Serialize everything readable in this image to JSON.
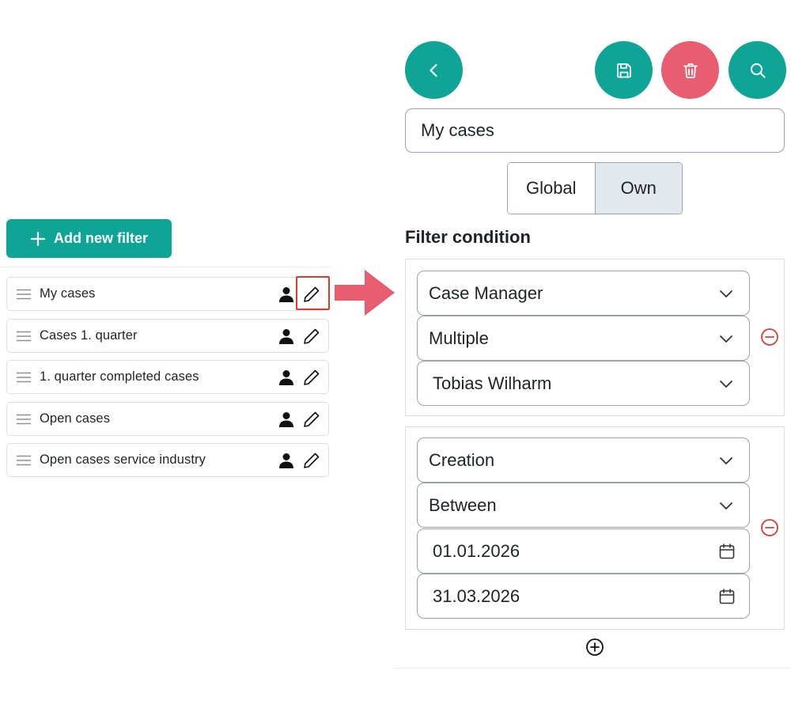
{
  "left_panel": {
    "add_filter_label": "Add new filter",
    "filters": [
      {
        "label": "My cases"
      },
      {
        "label": "Cases 1. quarter"
      },
      {
        "label": "1. quarter completed cases"
      },
      {
        "label": "Open cases"
      },
      {
        "label": "Open cases service industry"
      }
    ],
    "highlight_color": "#e03a2b",
    "arrow_color": "#e85d6f"
  },
  "toolbar": {
    "back_icon": "chevron-left-icon",
    "save_icon": "save-icon",
    "delete_icon": "trash-icon",
    "search_icon": "search-icon",
    "accent_color": "#0ea597",
    "danger_color": "#e85d6f"
  },
  "filter_name": {
    "value": "My cases"
  },
  "scope": {
    "options": [
      "Global",
      "Own"
    ],
    "selected": "Own"
  },
  "filter_condition": {
    "title": "Filter condition",
    "conditions": [
      {
        "field": "Case Manager",
        "operator": "Multiple",
        "values": [
          "Tobias Wilharm"
        ]
      },
      {
        "field": "Creation",
        "operator": "Between",
        "values": [
          "01.01.2026",
          "31.03.2026"
        ]
      }
    ],
    "add_icon": "plus-circle-icon",
    "remove_icon": "minus-circle-icon"
  }
}
